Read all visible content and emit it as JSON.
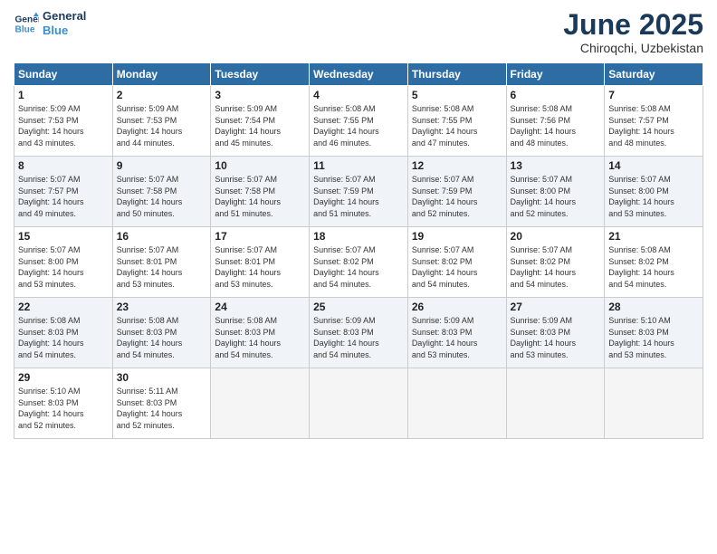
{
  "header": {
    "logo_line1": "General",
    "logo_line2": "Blue",
    "month": "June 2025",
    "location": "Chiroqchi, Uzbekistan"
  },
  "weekdays": [
    "Sunday",
    "Monday",
    "Tuesday",
    "Wednesday",
    "Thursday",
    "Friday",
    "Saturday"
  ],
  "weeks": [
    [
      {
        "day": "1",
        "info": "Sunrise: 5:09 AM\nSunset: 7:53 PM\nDaylight: 14 hours\nand 43 minutes."
      },
      {
        "day": "2",
        "info": "Sunrise: 5:09 AM\nSunset: 7:53 PM\nDaylight: 14 hours\nand 44 minutes."
      },
      {
        "day": "3",
        "info": "Sunrise: 5:09 AM\nSunset: 7:54 PM\nDaylight: 14 hours\nand 45 minutes."
      },
      {
        "day": "4",
        "info": "Sunrise: 5:08 AM\nSunset: 7:55 PM\nDaylight: 14 hours\nand 46 minutes."
      },
      {
        "day": "5",
        "info": "Sunrise: 5:08 AM\nSunset: 7:55 PM\nDaylight: 14 hours\nand 47 minutes."
      },
      {
        "day": "6",
        "info": "Sunrise: 5:08 AM\nSunset: 7:56 PM\nDaylight: 14 hours\nand 48 minutes."
      },
      {
        "day": "7",
        "info": "Sunrise: 5:08 AM\nSunset: 7:57 PM\nDaylight: 14 hours\nand 48 minutes."
      }
    ],
    [
      {
        "day": "8",
        "info": "Sunrise: 5:07 AM\nSunset: 7:57 PM\nDaylight: 14 hours\nand 49 minutes."
      },
      {
        "day": "9",
        "info": "Sunrise: 5:07 AM\nSunset: 7:58 PM\nDaylight: 14 hours\nand 50 minutes."
      },
      {
        "day": "10",
        "info": "Sunrise: 5:07 AM\nSunset: 7:58 PM\nDaylight: 14 hours\nand 51 minutes."
      },
      {
        "day": "11",
        "info": "Sunrise: 5:07 AM\nSunset: 7:59 PM\nDaylight: 14 hours\nand 51 minutes."
      },
      {
        "day": "12",
        "info": "Sunrise: 5:07 AM\nSunset: 7:59 PM\nDaylight: 14 hours\nand 52 minutes."
      },
      {
        "day": "13",
        "info": "Sunrise: 5:07 AM\nSunset: 8:00 PM\nDaylight: 14 hours\nand 52 minutes."
      },
      {
        "day": "14",
        "info": "Sunrise: 5:07 AM\nSunset: 8:00 PM\nDaylight: 14 hours\nand 53 minutes."
      }
    ],
    [
      {
        "day": "15",
        "info": "Sunrise: 5:07 AM\nSunset: 8:00 PM\nDaylight: 14 hours\nand 53 minutes."
      },
      {
        "day": "16",
        "info": "Sunrise: 5:07 AM\nSunset: 8:01 PM\nDaylight: 14 hours\nand 53 minutes."
      },
      {
        "day": "17",
        "info": "Sunrise: 5:07 AM\nSunset: 8:01 PM\nDaylight: 14 hours\nand 53 minutes."
      },
      {
        "day": "18",
        "info": "Sunrise: 5:07 AM\nSunset: 8:02 PM\nDaylight: 14 hours\nand 54 minutes."
      },
      {
        "day": "19",
        "info": "Sunrise: 5:07 AM\nSunset: 8:02 PM\nDaylight: 14 hours\nand 54 minutes."
      },
      {
        "day": "20",
        "info": "Sunrise: 5:07 AM\nSunset: 8:02 PM\nDaylight: 14 hours\nand 54 minutes."
      },
      {
        "day": "21",
        "info": "Sunrise: 5:08 AM\nSunset: 8:02 PM\nDaylight: 14 hours\nand 54 minutes."
      }
    ],
    [
      {
        "day": "22",
        "info": "Sunrise: 5:08 AM\nSunset: 8:03 PM\nDaylight: 14 hours\nand 54 minutes."
      },
      {
        "day": "23",
        "info": "Sunrise: 5:08 AM\nSunset: 8:03 PM\nDaylight: 14 hours\nand 54 minutes."
      },
      {
        "day": "24",
        "info": "Sunrise: 5:08 AM\nSunset: 8:03 PM\nDaylight: 14 hours\nand 54 minutes."
      },
      {
        "day": "25",
        "info": "Sunrise: 5:09 AM\nSunset: 8:03 PM\nDaylight: 14 hours\nand 54 minutes."
      },
      {
        "day": "26",
        "info": "Sunrise: 5:09 AM\nSunset: 8:03 PM\nDaylight: 14 hours\nand 53 minutes."
      },
      {
        "day": "27",
        "info": "Sunrise: 5:09 AM\nSunset: 8:03 PM\nDaylight: 14 hours\nand 53 minutes."
      },
      {
        "day": "28",
        "info": "Sunrise: 5:10 AM\nSunset: 8:03 PM\nDaylight: 14 hours\nand 53 minutes."
      }
    ],
    [
      {
        "day": "29",
        "info": "Sunrise: 5:10 AM\nSunset: 8:03 PM\nDaylight: 14 hours\nand 52 minutes."
      },
      {
        "day": "30",
        "info": "Sunrise: 5:11 AM\nSunset: 8:03 PM\nDaylight: 14 hours\nand 52 minutes."
      },
      {
        "day": "",
        "info": ""
      },
      {
        "day": "",
        "info": ""
      },
      {
        "day": "",
        "info": ""
      },
      {
        "day": "",
        "info": ""
      },
      {
        "day": "",
        "info": ""
      }
    ]
  ]
}
